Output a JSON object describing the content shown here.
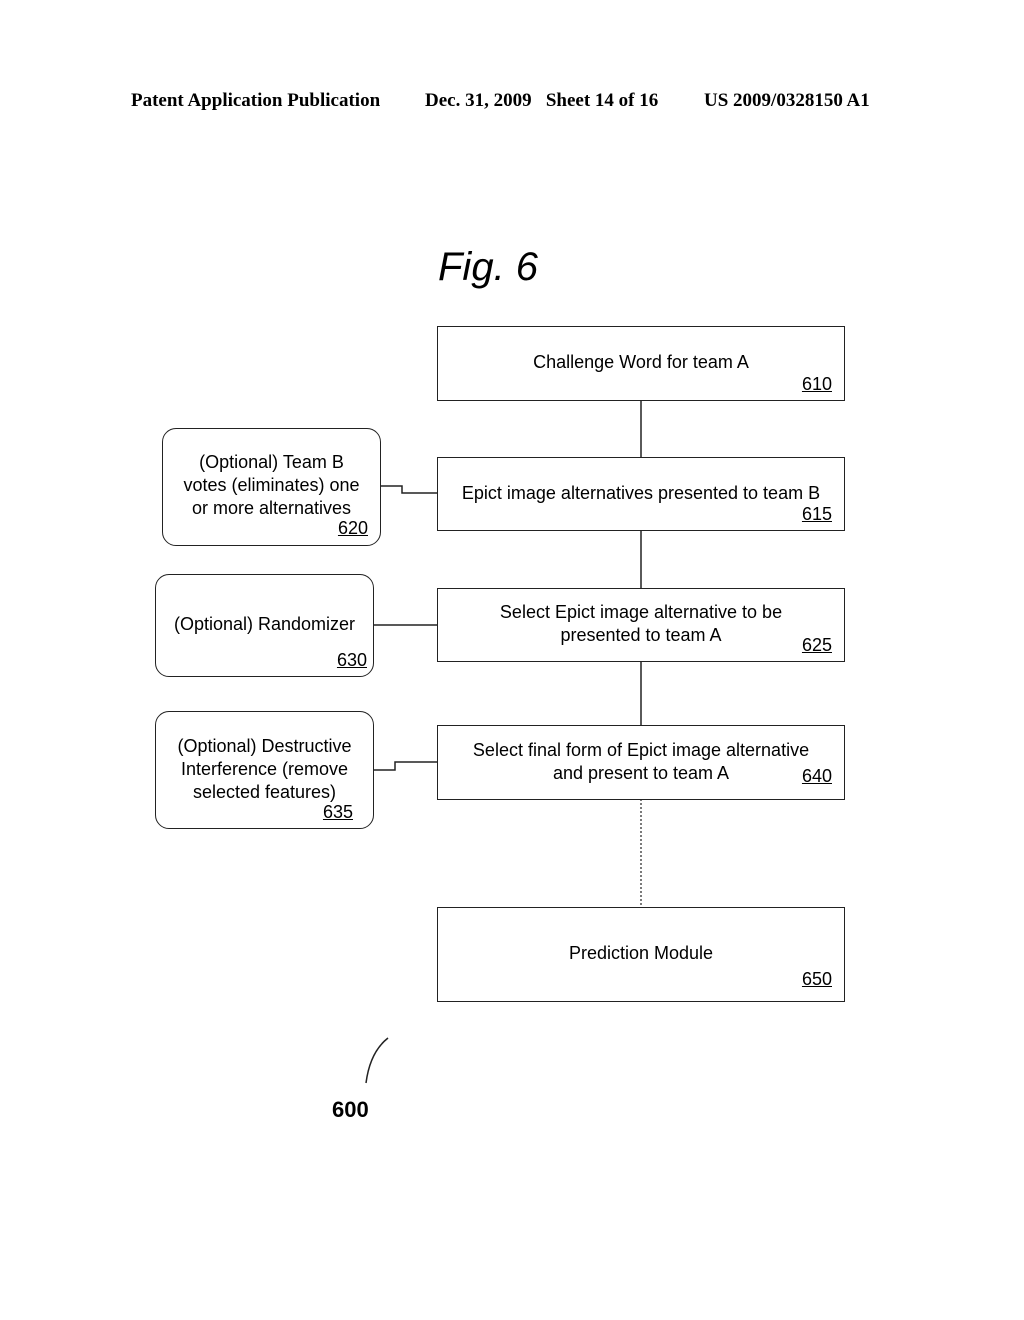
{
  "header": {
    "publication": "Patent Application Publication",
    "date_sheet": "Dec. 31, 2009   Sheet 14 of 16",
    "patent_number": "US 2009/0328150 A1"
  },
  "figure": {
    "title": "Fig. 6",
    "reference_label": "600"
  },
  "boxes": {
    "b610": {
      "text": "Challenge Word for team A",
      "ref": "610"
    },
    "b615": {
      "text": "Epict image alternatives presented to team B",
      "ref": "615"
    },
    "b620": {
      "line1": "(Optional) Team B",
      "line2": "votes (eliminates) one",
      "line3": "or more alternatives",
      "ref": "620"
    },
    "b625": {
      "line1": "Select Epict image alternative to be",
      "line2": "presented to team A",
      "ref": "625"
    },
    "b630": {
      "text": "(Optional) Randomizer",
      "ref": "630"
    },
    "b635": {
      "line1": "(Optional) Destructive",
      "line2": "Interference (remove",
      "line3": "selected features)",
      "ref": "635"
    },
    "b640": {
      "line1": "Select final form of Epict image alternative",
      "line2": "and present to team A",
      "ref": "640"
    },
    "b650": {
      "text": "Prediction Module",
      "ref": "650"
    }
  }
}
